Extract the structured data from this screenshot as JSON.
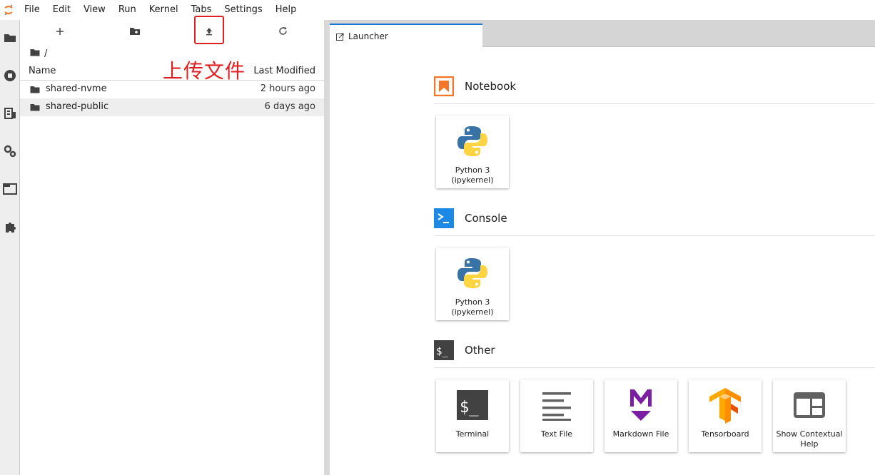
{
  "menubar": {
    "items": [
      "File",
      "Edit",
      "View",
      "Run",
      "Kernel",
      "Tabs",
      "Settings",
      "Help"
    ]
  },
  "activitybar": {
    "icons": [
      "folder-icon",
      "running-icon",
      "commands-icon",
      "property-inspector-icon",
      "tabs-icon",
      "extension-icon"
    ]
  },
  "filebrowser": {
    "toolbar": {
      "icons": [
        "new-launcher-icon",
        "new-folder-icon",
        "upload-icon",
        "refresh-icon"
      ]
    },
    "breadcrumb": "/",
    "annotation": "上传文件",
    "columns": {
      "name": "Name",
      "modified": "Last Modified"
    },
    "rows": [
      {
        "name": "shared-nvme",
        "modified": "2 hours ago"
      },
      {
        "name": "shared-public",
        "modified": "6 days ago"
      }
    ]
  },
  "tabs": [
    {
      "label": "Launcher"
    }
  ],
  "launcher": {
    "sections": [
      {
        "title": "Notebook",
        "cards": [
          {
            "label": "Python 3 (ipykernel)"
          }
        ]
      },
      {
        "title": "Console",
        "cards": [
          {
            "label": "Python 3 (ipykernel)"
          }
        ]
      },
      {
        "title": "Other",
        "cards": [
          {
            "label": "Terminal"
          },
          {
            "label": "Text File"
          },
          {
            "label": "Markdown File"
          },
          {
            "label": "Tensorboard"
          },
          {
            "label": "Show Contextual Help"
          }
        ]
      }
    ]
  },
  "colors": {
    "accent": "#1976d2",
    "notebook": "#f37726",
    "console": "#1e88e5",
    "annotation": "#e02020",
    "markdown": "#7b1fa2"
  }
}
